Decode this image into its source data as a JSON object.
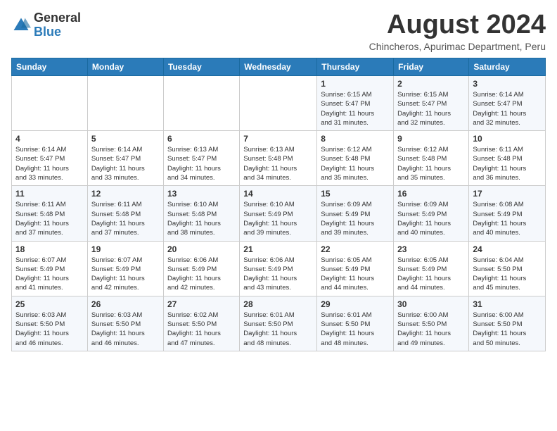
{
  "header": {
    "logo_general": "General",
    "logo_blue": "Blue",
    "month_year": "August 2024",
    "location": "Chincheros, Apurimac Department, Peru"
  },
  "days_of_week": [
    "Sunday",
    "Monday",
    "Tuesday",
    "Wednesday",
    "Thursday",
    "Friday",
    "Saturday"
  ],
  "weeks": [
    [
      {
        "day": "",
        "info": ""
      },
      {
        "day": "",
        "info": ""
      },
      {
        "day": "",
        "info": ""
      },
      {
        "day": "",
        "info": ""
      },
      {
        "day": "1",
        "info": "Sunrise: 6:15 AM\nSunset: 5:47 PM\nDaylight: 11 hours\nand 31 minutes."
      },
      {
        "day": "2",
        "info": "Sunrise: 6:15 AM\nSunset: 5:47 PM\nDaylight: 11 hours\nand 32 minutes."
      },
      {
        "day": "3",
        "info": "Sunrise: 6:14 AM\nSunset: 5:47 PM\nDaylight: 11 hours\nand 32 minutes."
      }
    ],
    [
      {
        "day": "4",
        "info": "Sunrise: 6:14 AM\nSunset: 5:47 PM\nDaylight: 11 hours\nand 33 minutes."
      },
      {
        "day": "5",
        "info": "Sunrise: 6:14 AM\nSunset: 5:47 PM\nDaylight: 11 hours\nand 33 minutes."
      },
      {
        "day": "6",
        "info": "Sunrise: 6:13 AM\nSunset: 5:47 PM\nDaylight: 11 hours\nand 34 minutes."
      },
      {
        "day": "7",
        "info": "Sunrise: 6:13 AM\nSunset: 5:48 PM\nDaylight: 11 hours\nand 34 minutes."
      },
      {
        "day": "8",
        "info": "Sunrise: 6:12 AM\nSunset: 5:48 PM\nDaylight: 11 hours\nand 35 minutes."
      },
      {
        "day": "9",
        "info": "Sunrise: 6:12 AM\nSunset: 5:48 PM\nDaylight: 11 hours\nand 35 minutes."
      },
      {
        "day": "10",
        "info": "Sunrise: 6:11 AM\nSunset: 5:48 PM\nDaylight: 11 hours\nand 36 minutes."
      }
    ],
    [
      {
        "day": "11",
        "info": "Sunrise: 6:11 AM\nSunset: 5:48 PM\nDaylight: 11 hours\nand 37 minutes."
      },
      {
        "day": "12",
        "info": "Sunrise: 6:11 AM\nSunset: 5:48 PM\nDaylight: 11 hours\nand 37 minutes."
      },
      {
        "day": "13",
        "info": "Sunrise: 6:10 AM\nSunset: 5:48 PM\nDaylight: 11 hours\nand 38 minutes."
      },
      {
        "day": "14",
        "info": "Sunrise: 6:10 AM\nSunset: 5:49 PM\nDaylight: 11 hours\nand 39 minutes."
      },
      {
        "day": "15",
        "info": "Sunrise: 6:09 AM\nSunset: 5:49 PM\nDaylight: 11 hours\nand 39 minutes."
      },
      {
        "day": "16",
        "info": "Sunrise: 6:09 AM\nSunset: 5:49 PM\nDaylight: 11 hours\nand 40 minutes."
      },
      {
        "day": "17",
        "info": "Sunrise: 6:08 AM\nSunset: 5:49 PM\nDaylight: 11 hours\nand 40 minutes."
      }
    ],
    [
      {
        "day": "18",
        "info": "Sunrise: 6:07 AM\nSunset: 5:49 PM\nDaylight: 11 hours\nand 41 minutes."
      },
      {
        "day": "19",
        "info": "Sunrise: 6:07 AM\nSunset: 5:49 PM\nDaylight: 11 hours\nand 42 minutes."
      },
      {
        "day": "20",
        "info": "Sunrise: 6:06 AM\nSunset: 5:49 PM\nDaylight: 11 hours\nand 42 minutes."
      },
      {
        "day": "21",
        "info": "Sunrise: 6:06 AM\nSunset: 5:49 PM\nDaylight: 11 hours\nand 43 minutes."
      },
      {
        "day": "22",
        "info": "Sunrise: 6:05 AM\nSunset: 5:49 PM\nDaylight: 11 hours\nand 44 minutes."
      },
      {
        "day": "23",
        "info": "Sunrise: 6:05 AM\nSunset: 5:49 PM\nDaylight: 11 hours\nand 44 minutes."
      },
      {
        "day": "24",
        "info": "Sunrise: 6:04 AM\nSunset: 5:50 PM\nDaylight: 11 hours\nand 45 minutes."
      }
    ],
    [
      {
        "day": "25",
        "info": "Sunrise: 6:03 AM\nSunset: 5:50 PM\nDaylight: 11 hours\nand 46 minutes."
      },
      {
        "day": "26",
        "info": "Sunrise: 6:03 AM\nSunset: 5:50 PM\nDaylight: 11 hours\nand 46 minutes."
      },
      {
        "day": "27",
        "info": "Sunrise: 6:02 AM\nSunset: 5:50 PM\nDaylight: 11 hours\nand 47 minutes."
      },
      {
        "day": "28",
        "info": "Sunrise: 6:01 AM\nSunset: 5:50 PM\nDaylight: 11 hours\nand 48 minutes."
      },
      {
        "day": "29",
        "info": "Sunrise: 6:01 AM\nSunset: 5:50 PM\nDaylight: 11 hours\nand 48 minutes."
      },
      {
        "day": "30",
        "info": "Sunrise: 6:00 AM\nSunset: 5:50 PM\nDaylight: 11 hours\nand 49 minutes."
      },
      {
        "day": "31",
        "info": "Sunrise: 6:00 AM\nSunset: 5:50 PM\nDaylight: 11 hours\nand 50 minutes."
      }
    ]
  ]
}
